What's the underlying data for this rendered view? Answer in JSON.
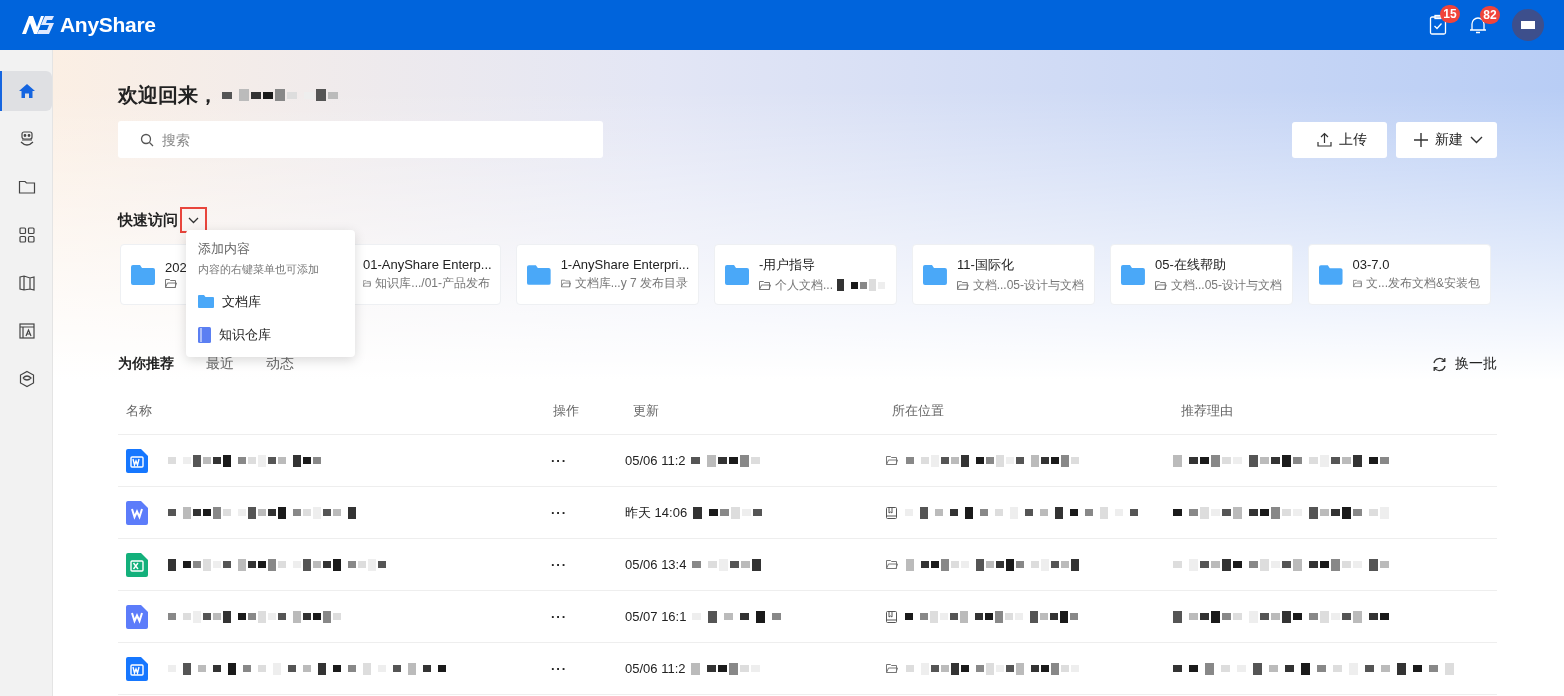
{
  "app": {
    "logo": "AnyShare"
  },
  "header": {
    "badges": [
      {
        "kind": "tasks",
        "count": "15"
      },
      {
        "kind": "bell",
        "count": "82"
      }
    ]
  },
  "sidebar": {
    "items": [
      {
        "kind": "home",
        "selected": true
      },
      {
        "kind": "robot",
        "selected": false
      },
      {
        "kind": "folder",
        "selected": false
      },
      {
        "kind": "apps",
        "selected": false
      },
      {
        "kind": "map",
        "selected": false
      },
      {
        "kind": "template",
        "selected": false
      },
      {
        "kind": "cube",
        "selected": false
      }
    ]
  },
  "greeting": "欢迎回来，",
  "search": {
    "placeholder": "搜索"
  },
  "actions": [
    {
      "kind": "upload",
      "label": "上传"
    },
    {
      "kind": "new",
      "label": "新建"
    }
  ],
  "quick_access": {
    "title": "快速访问",
    "cards": [
      {
        "title": "202"
      },
      {
        "title": "01-AnyShare Enterp...",
        "path": "知识库.../01-产品发布"
      },
      {
        "title": "1-AnyShare Enterpri...",
        "path": "文档库...y 7 发布目录"
      },
      {
        "title": "-用户指导",
        "path": "个人文档..."
      },
      {
        "title": "11-国际化",
        "path": "文档...05-设计与文档"
      },
      {
        "title": "05-在线帮助",
        "path": "文档...05-设计与文档"
      },
      {
        "title": "03-7.0",
        "path": "文...发布文档&安装包"
      }
    ]
  },
  "menu": {
    "title": "添加内容",
    "hint": "内容的右键菜单也可添加",
    "items": [
      {
        "kind": "library",
        "label": "文档库"
      },
      {
        "kind": "knowledge",
        "label": "知识仓库"
      }
    ]
  },
  "tabs": [
    {
      "label": "为你推荐",
      "selected": true
    },
    {
      "label": "最近",
      "selected": false
    },
    {
      "label": "动态",
      "selected": false
    }
  ],
  "refresh": "换一批",
  "table": {
    "columns": [
      "名称",
      "操作",
      "更新",
      "所在位置",
      "推荐理由"
    ],
    "rows": [
      {
        "kind": "word",
        "actions": "···",
        "updated": "05/06 11:2",
        "location": {
          "kind": "folder"
        }
      },
      {
        "kind": "wps",
        "actions": "···",
        "updated": "昨天 14:06",
        "location": {
          "kind": "book"
        }
      },
      {
        "kind": "excel",
        "actions": "···",
        "updated": "05/06 13:4",
        "location": {
          "kind": "folder"
        }
      },
      {
        "kind": "wps",
        "actions": "···",
        "updated": "05/07 16:1",
        "location": {
          "kind": "book"
        }
      },
      {
        "kind": "word",
        "actions": "···",
        "updated": "05/06 11:2",
        "location": {
          "kind": "folder"
        }
      }
    ]
  }
}
